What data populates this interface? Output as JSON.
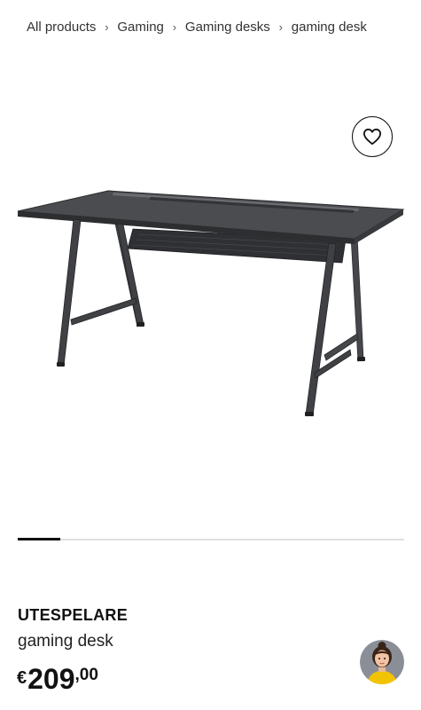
{
  "breadcrumb": {
    "items": [
      "All products",
      "Gaming",
      "Gaming desks",
      "gaming desk"
    ],
    "separator": "›"
  },
  "favorite": {
    "icon": "heart-icon"
  },
  "carousel": {
    "position": 1,
    "progress_fraction": 0.11
  },
  "product": {
    "name": "UTESPELARE",
    "description": "gaming desk",
    "price": {
      "currency": "€",
      "integer": "209",
      "decimal": ",00"
    }
  },
  "assistant": {
    "icon": "assistant-avatar-icon"
  },
  "colors": {
    "text": "#111111",
    "track": "#dfdfdf",
    "desk": "#3a3b3d",
    "avatar_bg": "#8a8f97",
    "avatar_shirt": "#f2c400"
  }
}
